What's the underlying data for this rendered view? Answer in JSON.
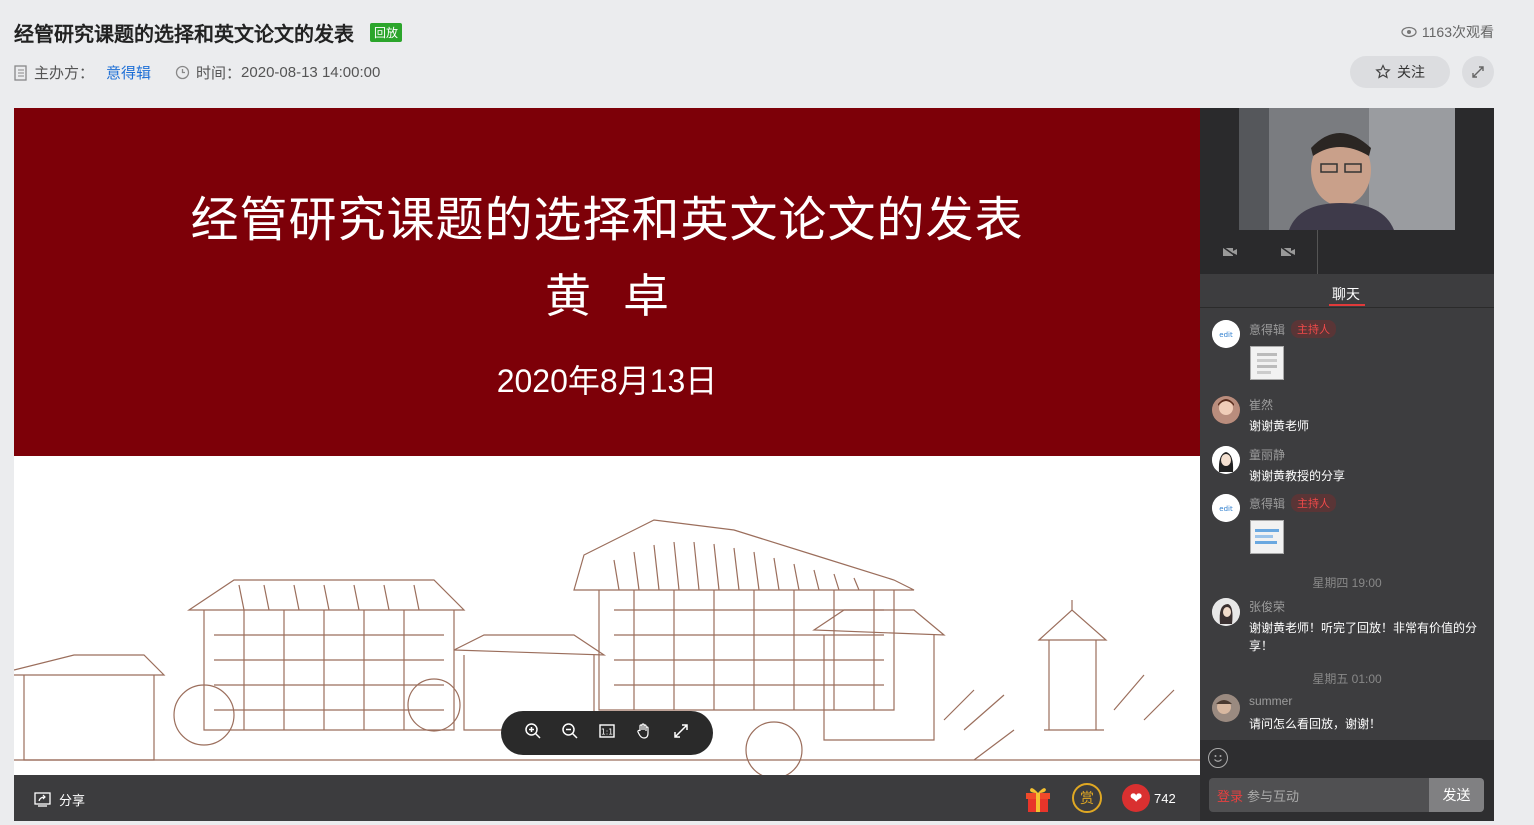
{
  "header": {
    "title": "经管研究课题的选择和英文论文的发表",
    "badge": "回放",
    "views": "1163次观看",
    "organizer_label": "主办方：",
    "organizer": "意得辑",
    "time_label": "时间：",
    "time": "2020-08-13 14:00:00",
    "follow_label": "关注"
  },
  "slide": {
    "title": "经管研究课题的选择和英文论文的发表",
    "author": "黄卓",
    "date": "2020年8月13日"
  },
  "bottom_bar": {
    "share_label": "分享",
    "reward_label": "赏",
    "likes": "742"
  },
  "side": {
    "tab": "聊天",
    "messages": [
      {
        "user": "意得辑",
        "badge": "主持人",
        "text": "",
        "image": true
      },
      {
        "user": "崔然",
        "text": "谢谢黄老师"
      },
      {
        "user": "童丽静",
        "text": "谢谢黄教授的分享"
      },
      {
        "user": "意得辑",
        "badge": "主持人",
        "text": "",
        "image": true
      },
      {
        "user": "张俊荣",
        "text": "谢谢黄老师！听完了回放！非常有价值的分享！"
      },
      {
        "user": "summer",
        "text": "请问怎么看回放，谢谢！"
      }
    ],
    "timestamps": [
      "星期四 19:00",
      "星期五 01:00"
    ],
    "input_login": "登录",
    "input_placeholder": "参与互动",
    "send_label": "发送"
  },
  "colors": {
    "slide_red": "#7d0008",
    "accent_red": "#e03a3a",
    "badge_green": "#2ba52b",
    "link_blue": "#1e6fd6"
  }
}
